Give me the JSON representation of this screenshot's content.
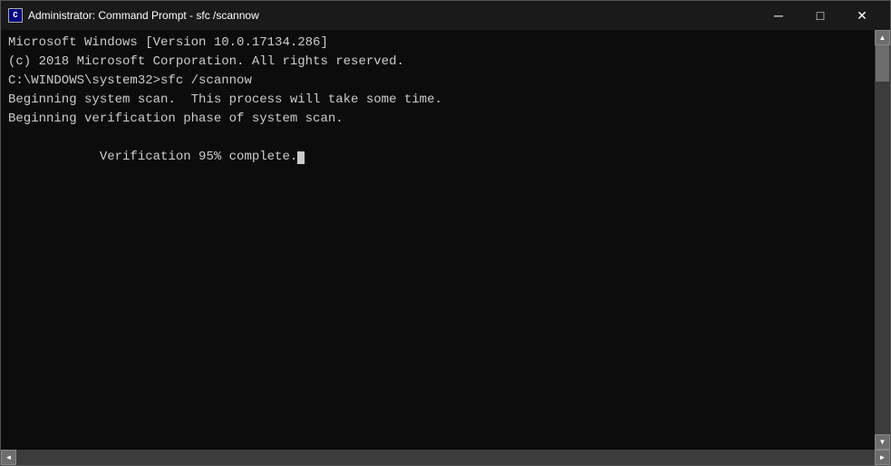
{
  "titleBar": {
    "icon": "C>",
    "title": "Administrator: Command Prompt - sfc /scannow",
    "minimizeLabel": "─",
    "maximizeLabel": "□",
    "closeLabel": "✕"
  },
  "terminal": {
    "lines": [
      "Microsoft Windows [Version 10.0.17134.286]",
      "(c) 2018 Microsoft Corporation. All rights reserved.",
      "",
      "C:\\WINDOWS\\system32>sfc /scannow",
      "",
      "Beginning system scan.  This process will take some time.",
      "",
      "Beginning verification phase of system scan.",
      "Verification 95% complete."
    ]
  }
}
